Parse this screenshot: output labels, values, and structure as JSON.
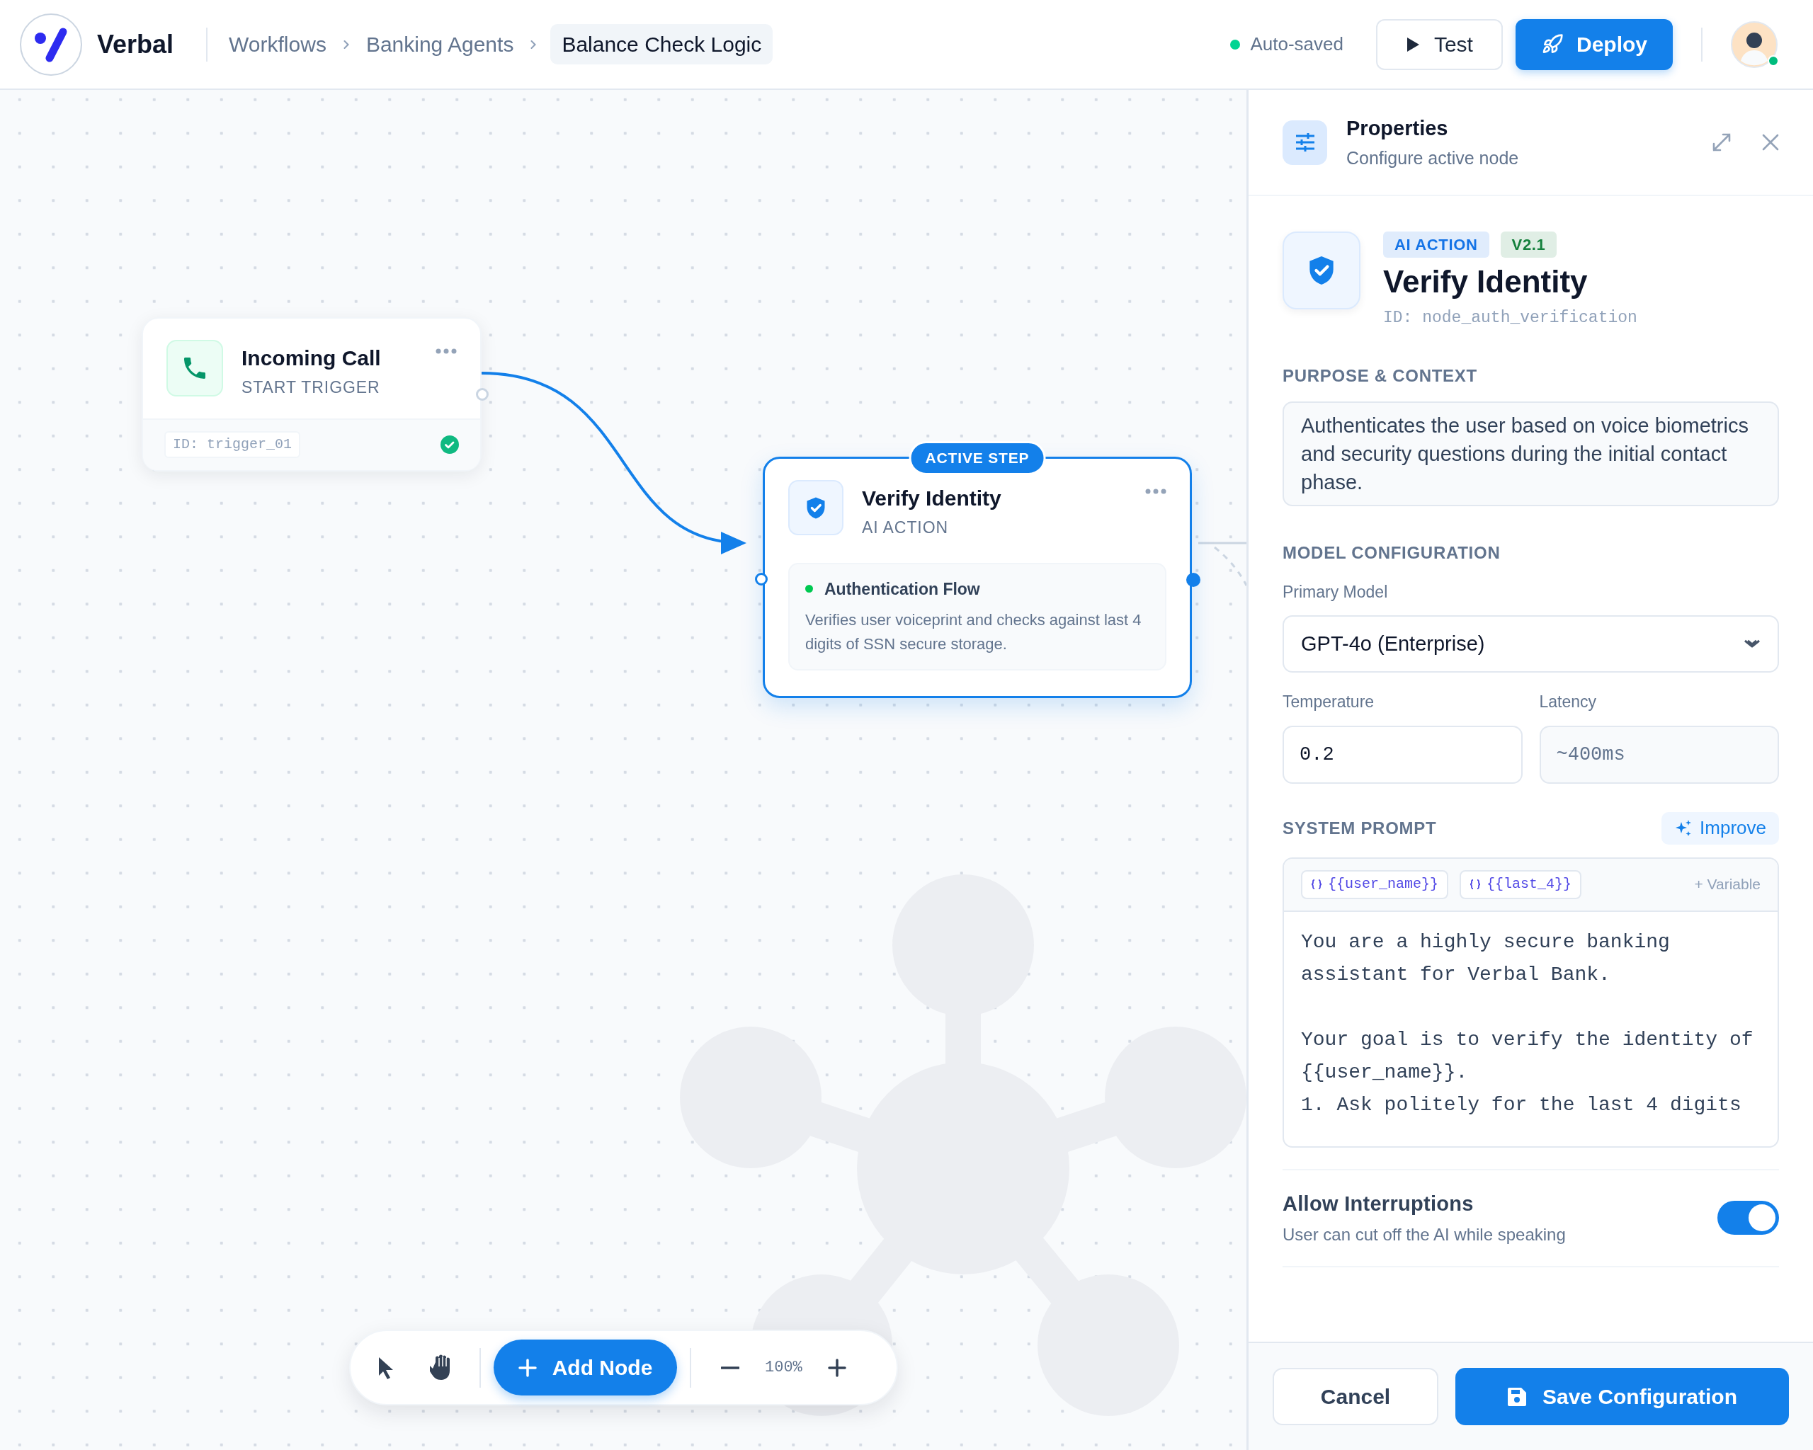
{
  "header": {
    "brand": "Verbal",
    "breadcrumbs": [
      {
        "label": "Workflows",
        "current": false
      },
      {
        "label": "Banking Agents",
        "current": false
      },
      {
        "label": "Balance Check Logic",
        "current": true
      }
    ],
    "save_status": "Auto-saved",
    "test_button": "Test",
    "deploy_button": "Deploy",
    "avatar": {
      "online": true
    }
  },
  "canvas": {
    "nodes": [
      {
        "kind": "trigger",
        "selected": false,
        "title": "Incoming Call",
        "subtitle": "START TRIGGER",
        "id_label": "ID: trigger_01",
        "valid": true
      },
      {
        "kind": "action",
        "selected": true,
        "badge": "ACTIVE STEP",
        "title": "Verify Identity",
        "subtitle": "AI ACTION",
        "card_title": "Authentication Flow",
        "card_text": "Verifies user voiceprint and checks against last 4 digits of SSN secure storage."
      }
    ],
    "toolbar": {
      "add_node": "Add Node",
      "zoom": "100%"
    }
  },
  "panel": {
    "title": "Properties",
    "subtitle": "Configure active node",
    "node": {
      "badges": [
        {
          "label": "AI ACTION",
          "color": "#1473e6"
        },
        {
          "label": "V2.1",
          "color": "#15803d"
        }
      ],
      "title": "Verify Identity",
      "id_label": "ID: node_auth_verification"
    },
    "purpose": {
      "label": "PURPOSE & CONTEXT",
      "text": "Authenticates the user based on voice biometrics and security questions during the initial contact phase."
    },
    "model": {
      "label": "MODEL CONFIGURATION",
      "primary_label": "Primary Model",
      "primary_value": "GPT-4o (Enterprise)",
      "fields": [
        {
          "label": "Temperature",
          "value": "0.2",
          "readonly": false
        },
        {
          "label": "Latency",
          "value": "~400ms",
          "readonly": true
        }
      ]
    },
    "prompt": {
      "label": "SYSTEM PROMPT",
      "improve": "Improve",
      "variables": [
        "{{user_name}}",
        "{{last_4}}"
      ],
      "add_variable": "+ Variable",
      "text": "You are a highly secure banking\nassistant for Verbal Bank.\n\nYour goal is to verify the identity of\n{{user_name}}.\n1. Ask politely for the last 4 digits"
    },
    "toggle": {
      "label": "Allow Interruptions",
      "description": "User can cut off the AI while speaking",
      "on": true
    },
    "footer": {
      "cancel": "Cancel",
      "save": "Save Configuration"
    }
  }
}
